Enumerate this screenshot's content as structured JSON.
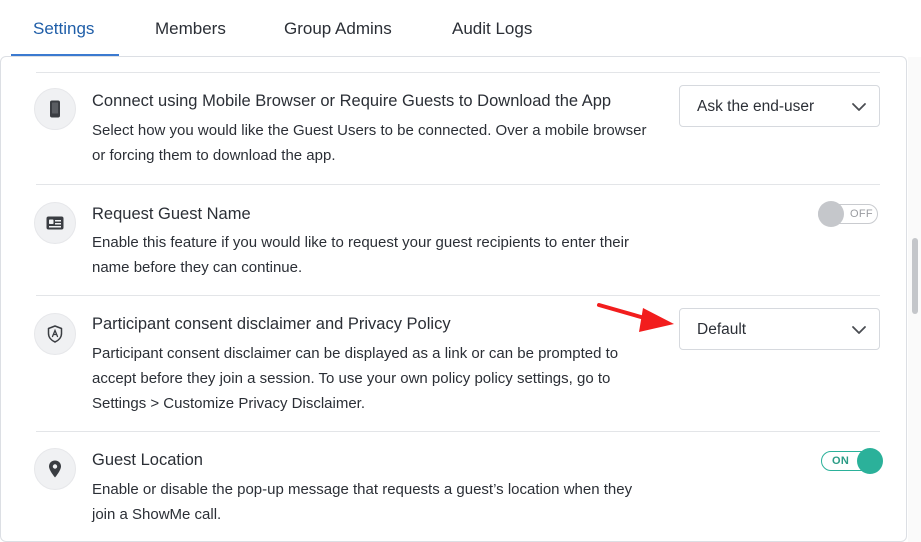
{
  "tabs": [
    {
      "label": "Settings",
      "active": true
    },
    {
      "label": "Members",
      "active": false
    },
    {
      "label": "Group Admins",
      "active": false
    },
    {
      "label": "Audit Logs",
      "active": false
    }
  ],
  "settings": [
    {
      "icon": "mobile-phone-icon",
      "title": "Connect using Mobile Browser or Require Guests to Download the App",
      "description": "Select how you would like the Guest Users to be connected. Over a mobile browser or forcing them to download the app.",
      "control": {
        "type": "dropdown",
        "value": "Ask the end-user"
      }
    },
    {
      "icon": "id-card-icon",
      "title": "Request Guest Name",
      "description": "Enable this feature if you would like to request your guest recipients to enter their name before they can continue.",
      "control": {
        "type": "toggle",
        "state": "OFF"
      }
    },
    {
      "icon": "shield-icon",
      "title": "Participant consent disclaimer and Privacy Policy",
      "description": "Participant consent disclaimer can be displayed as a link or can be prompted to accept before they join a session. To use your own policy policy settings, go to Settings > Customize Privacy Disclaimer.",
      "control": {
        "type": "dropdown",
        "value": "Default"
      }
    },
    {
      "icon": "map-pin-icon",
      "title": "Guest Location",
      "description": "Enable or disable the pop-up message that requests a guest’s location when they join a ShowMe call.",
      "control": {
        "type": "toggle",
        "state": "ON"
      }
    }
  ],
  "colors": {
    "accent": "#1f5ea8",
    "tab_underline": "#3b7ad0",
    "toggle_on": "#2bb19a",
    "toggle_off": "#c5c7cb",
    "annotation_arrow": "#f21d1d"
  },
  "annotation": {
    "icon": "red-arrow-icon",
    "points_to": "privacy-policy-dropdown"
  }
}
